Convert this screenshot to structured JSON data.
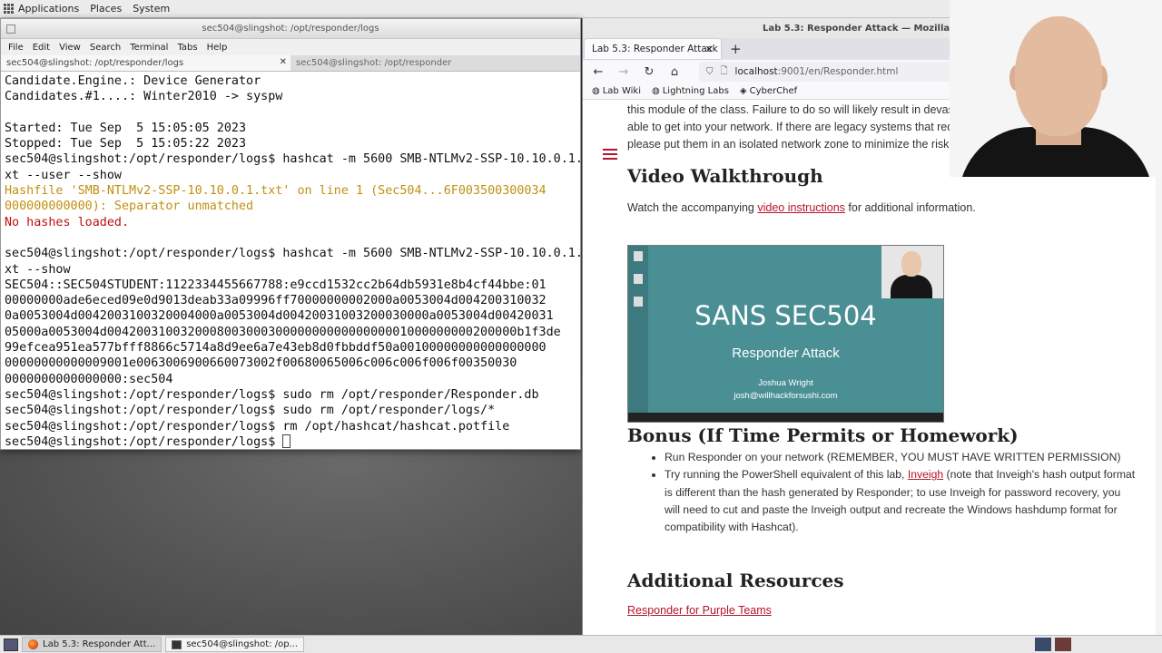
{
  "top_panel": {
    "applications": "Applications",
    "places": "Places",
    "system": "System"
  },
  "terminal": {
    "title": "sec504@slingshot: /opt/responder/logs",
    "menu": [
      "File",
      "Edit",
      "View",
      "Search",
      "Terminal",
      "Tabs",
      "Help"
    ],
    "tabs": [
      "sec504@slingshot: /opt/responder/logs",
      "sec504@slingshot: /opt/responder"
    ],
    "lines": [
      {
        "text": "Candidate.Engine.: Device Generator",
        "style": ""
      },
      {
        "text": "Candidates.#1....: Winter2010 -> syspw",
        "style": ""
      },
      {
        "text": "",
        "style": ""
      },
      {
        "text": "Started: Tue Sep  5 15:05:05 2023",
        "style": ""
      },
      {
        "text": "Stopped: Tue Sep  5 15:05:22 2023",
        "style": ""
      },
      {
        "text": "sec504@slingshot:/opt/responder/logs$ hashcat -m 5600 SMB-NTLMv2-SSP-10.10.0.1.t",
        "style": ""
      },
      {
        "text": "xt --user --show",
        "style": ""
      },
      {
        "text": "Hashfile 'SMB-NTLMv2-SSP-10.10.0.1.txt' on line 1 (Sec504...6F003500300034",
        "style": "warn"
      },
      {
        "text": "000000000000): Separator unmatched",
        "style": "warn"
      },
      {
        "text": "No hashes loaded.",
        "style": "err"
      },
      {
        "text": "",
        "style": ""
      },
      {
        "text": "sec504@slingshot:/opt/responder/logs$ hashcat -m 5600 SMB-NTLMv2-SSP-10.10.0.1.t",
        "style": ""
      },
      {
        "text": "xt --show",
        "style": ""
      },
      {
        "text": "SEC504::SEC504STUDENT:1122334455667788:e9ccd1532cc2b64db5931e8b4cf44bbe:01",
        "style": ""
      },
      {
        "text": "00000000ade6eced09e0d9013deab33a09996ff70000000002000a0053004d004200310032",
        "style": ""
      },
      {
        "text": "0a0053004d0042003100320004000a0053004d00420031003200030000a0053004d00420031",
        "style": ""
      },
      {
        "text": "05000a0053004d00420031003200080030003000000000000000001000000000200000b1f3de",
        "style": ""
      },
      {
        "text": "99efcea951ea577bfff8866c5714a8d9ee6a7e43eb8d0fbbddf50a00100000000000000000",
        "style": ""
      },
      {
        "text": "00000000000009001e0063006900660073002f00680065006c006c006f006f00350030",
        "style": ""
      },
      {
        "text": "0000000000000000:sec504",
        "style": ""
      },
      {
        "text": "sec504@slingshot:/opt/responder/logs$ sudo rm /opt/responder/Responder.db",
        "style": ""
      },
      {
        "text": "sec504@slingshot:/opt/responder/logs$ sudo rm /opt/responder/logs/*",
        "style": ""
      },
      {
        "text": "sec504@slingshot:/opt/responder/logs$ rm /opt/hashcat/hashcat.potfile",
        "style": ""
      },
      {
        "text": "sec504@slingshot:/opt/responder/logs$ ",
        "style": "prompt"
      }
    ]
  },
  "firefox": {
    "title": "Lab 5.3: Responder Attack — Mozilla Firefox",
    "tab_label": "Lab 5.3: Responder Attack",
    "url_host": "localhost",
    "url_path": ":9001/en/Responder.html",
    "bookmarks": [
      "Lab Wiki",
      "Lightning Labs",
      "CyberChef"
    ]
  },
  "page": {
    "intro_lines": [
      "this module of the class. Failure to do so will likely result in devast",
      "able to get into your network. If there are legacy systems that requ",
      "please put them in an isolated network zone to minimize the risk t"
    ],
    "video_heading": "Video Walkthrough",
    "watch_prefix": "Watch the accompanying ",
    "watch_link": "video instructions",
    "watch_suffix": " for additional information.",
    "video": {
      "title": "SANS SEC504",
      "subtitle": "Responder Attack",
      "author": "Joshua Wright",
      "email": "josh@willhackforsushi.com"
    },
    "bonus_heading": "Bonus (If Time Permits or Homework)",
    "bonus_item1": "Run Responder on your network (REMEMBER, YOU MUST HAVE WRITTEN PERMISSION)",
    "bonus_item2_prefix": "Try running the PowerShell equivalent of this lab, ",
    "bonus_item2_link": "Inveigh",
    "bonus_item2_suffix": " (note that Inveigh's hash output format is different than the hash generated by Responder; to use Inveigh for password recovery, you will need to cut and paste the Inveigh output and recreate the Windows hashdump format for compatibility with Hashcat).",
    "resources_heading": "Additional Resources",
    "resource_link": "Responder for Purple Teams"
  },
  "taskbar": {
    "items": [
      "Lab 5.3: Responder Att...",
      "sec504@slingshot: /op..."
    ]
  },
  "colors": {
    "link": "#b5142a",
    "warn": "#c09010",
    "error": "#c01010"
  }
}
